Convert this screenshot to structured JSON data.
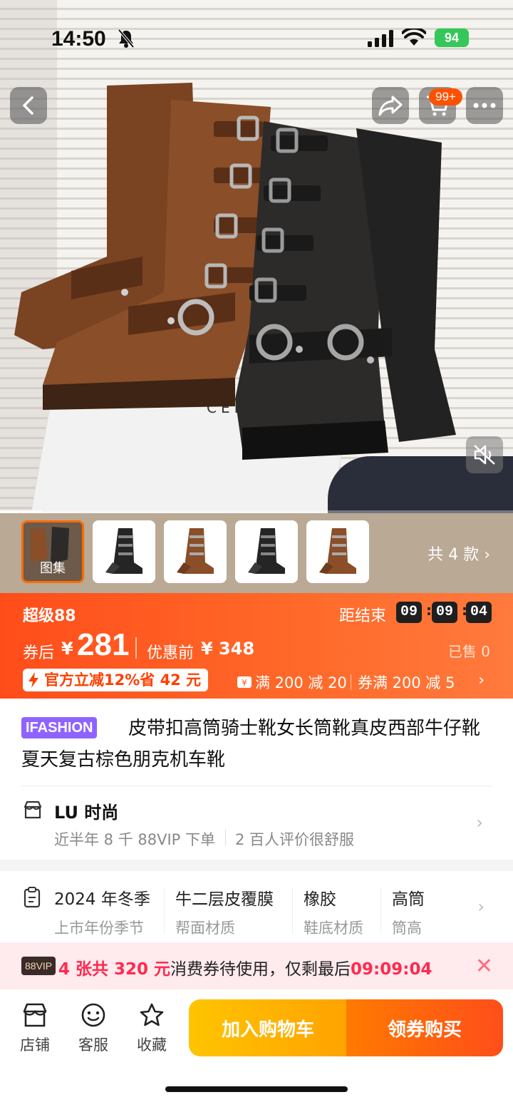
{
  "status_bar": {
    "time": "14:50",
    "battery": "94"
  },
  "hero": {
    "box_brand_text": "CEL",
    "gallery_progress": 0.08
  },
  "header": {
    "cart_badge": "99+"
  },
  "gallery": {
    "atlas_label": "图集",
    "styles_count": "共 4 款"
  },
  "promo": {
    "event_name": "超级88",
    "ends_label": "距结束",
    "countdown": [
      "09",
      "09",
      "04"
    ],
    "after_coupon_label": "券后",
    "currency": "¥",
    "price_after": "281",
    "before_label": "优惠前",
    "price_before": "¥ 348",
    "sold": "已售 0",
    "official_discount": "官方立减12%省 42 元",
    "coupon_1": "满 200 减 20",
    "coupon_2": "券满 200 减 5"
  },
  "product": {
    "brand_tag": "IFASHION",
    "title": "皮带扣高筒骑士靴女长筒靴真皮西部牛仔靴夏天复古棕色朋克机车靴"
  },
  "store": {
    "name": "LU 时尚",
    "sales_info": "近半年 8 千 88VIP 下单",
    "review_info": "2 百人评价很舒服"
  },
  "specs": [
    {
      "value": "2024 年冬季",
      "label": "上市年份季节"
    },
    {
      "value": "牛二层皮覆膜",
      "label": "帮面材质"
    },
    {
      "value": "橡胶",
      "label": "鞋底材质"
    },
    {
      "value": "高筒",
      "label": "筒高"
    }
  ],
  "vip_banner": {
    "badge": "88VIP",
    "highlight": "4 张共 320 元",
    "middle_text": "消费券待使用，仅剩最后",
    "countdown": "09:09:04"
  },
  "bottom_bar": {
    "store_label": "店铺",
    "service_label": "客服",
    "favorite_label": "收藏",
    "add_to_cart": "加入购物车",
    "buy_with_coupon": "领券购买"
  },
  "colors": {
    "accent_orange": "#ff5000",
    "promo_gradient_start": "#ff4d1a",
    "brand_purple": "#8f63ff",
    "vip_red": "#ff2a4f",
    "cart_yellow": "#ffc400"
  }
}
